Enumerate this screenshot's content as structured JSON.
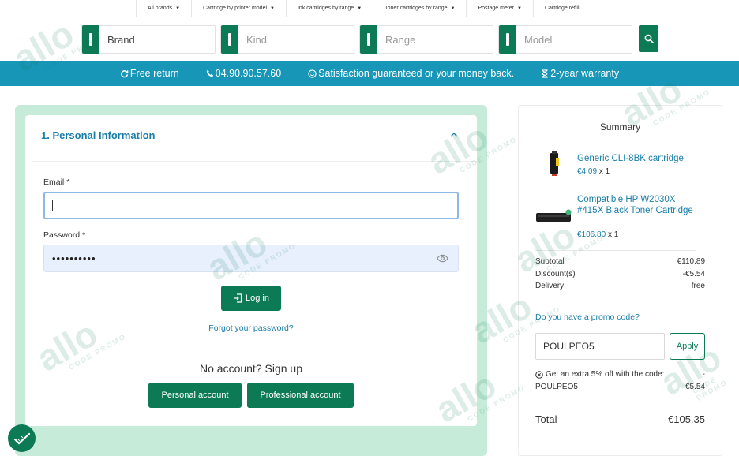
{
  "topnav": {
    "items": [
      {
        "label": "All brands"
      },
      {
        "label": "Cartridge by printer model"
      },
      {
        "label": "Ink cartridges by range"
      },
      {
        "label": "Toner cartridges by range"
      },
      {
        "label": "Postage meter"
      },
      {
        "label": "Cartridge refill"
      }
    ]
  },
  "filters": {
    "brand": "Brand",
    "kind": "Kind",
    "range": "Range",
    "model": "Model",
    "search_icon": "search-icon"
  },
  "banner": {
    "free_return": "Free return",
    "phone": "04.90.90.57.60",
    "satisfaction": "Satisfaction guaranteed or your money back.",
    "warranty": "2-year warranty"
  },
  "login": {
    "section_title": "1. Personal Information",
    "email_label": "Email",
    "email_value": "",
    "password_label": "Password",
    "password_value": "••••••••••",
    "required_mark": "*",
    "login_button": "Log in",
    "forgot_link": "Forgot your password?",
    "no_account": "No account? Sign up",
    "personal_account": "Personal account",
    "professional_account": "Professional account"
  },
  "summary": {
    "title": "Summary",
    "products": [
      {
        "name": "Generic CLI-8BK cartridge",
        "price": "€4.09",
        "qty": "x 1"
      },
      {
        "name": "Compatible HP W2030X #415X Black Toner Cartridge",
        "price": "€106.80",
        "qty": "x 1"
      }
    ],
    "subtotal_label": "Subtotal",
    "subtotal_value": "€110.89",
    "discount_label": "Discount(s)",
    "discount_value": "-€5.54",
    "delivery_label": "Delivery",
    "delivery_value": "free",
    "promo_link": "Do you have a promo code?",
    "promo_value": "POULPEO5",
    "apply_button": "Apply",
    "extra_text": "Get an extra 5% off with the code:",
    "extra_dash": "-",
    "code_name": "POULPEO5",
    "code_value": "€5.54",
    "total_label": "Total",
    "total_value": "€105.35"
  },
  "watermark": {
    "brand": "allo",
    "tagline": "CODE PROMO"
  },
  "colors": {
    "accent": "#0b7a55",
    "banner": "#1896b7",
    "link": "#1a7ea8",
    "frame": "#c6ecd9"
  }
}
